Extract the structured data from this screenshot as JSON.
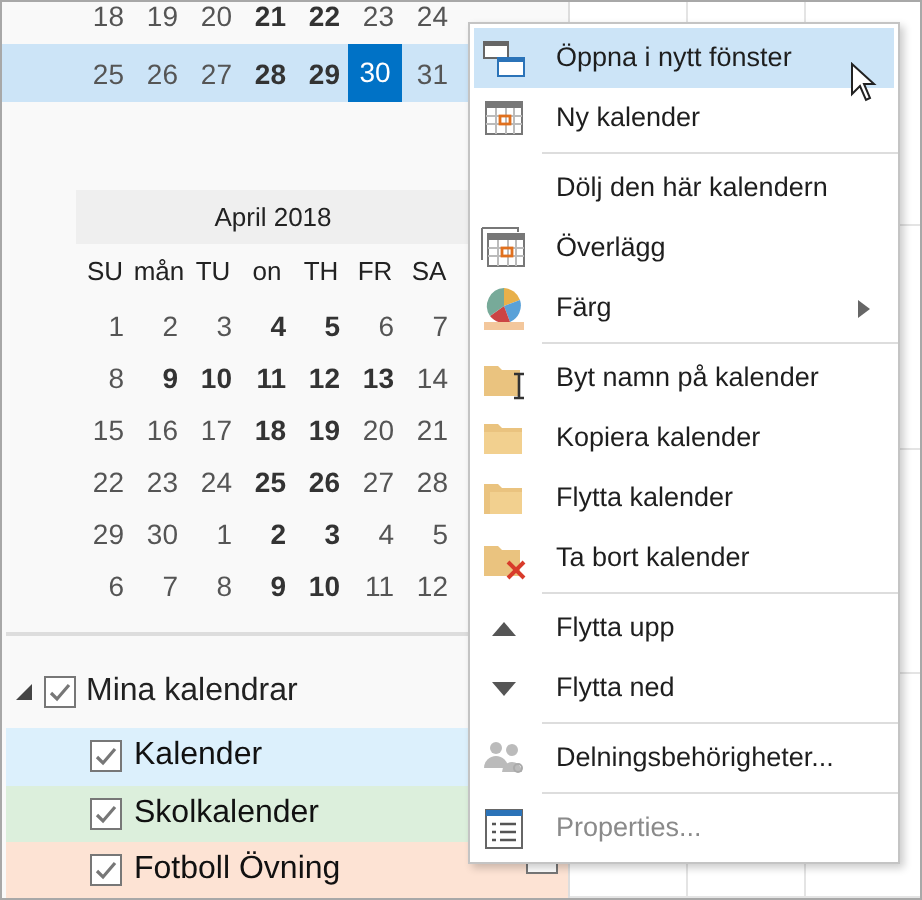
{
  "prev_month_rows": [
    {
      "selected": false,
      "days": [
        {
          "text": "18",
          "bold": false,
          "selected": false
        },
        {
          "text": "19",
          "bold": false,
          "selected": false
        },
        {
          "text": "20",
          "bold": false,
          "selected": false
        },
        {
          "text": "21",
          "bold": true,
          "selected": false
        },
        {
          "text": "22",
          "bold": true,
          "selected": false
        },
        {
          "text": "23",
          "bold": false,
          "selected": false
        },
        {
          "text": "24",
          "bold": false,
          "selected": false
        }
      ]
    },
    {
      "selected": true,
      "days": [
        {
          "text": "25",
          "bold": false,
          "selected": false
        },
        {
          "text": "26",
          "bold": false,
          "selected": false
        },
        {
          "text": "27",
          "bold": false,
          "selected": false
        },
        {
          "text": "28",
          "bold": true,
          "selected": false
        },
        {
          "text": "29",
          "bold": true,
          "selected": false
        },
        {
          "text": "30",
          "bold": false,
          "selected": true
        },
        {
          "text": "31",
          "bold": false,
          "selected": false
        }
      ]
    }
  ],
  "month": {
    "title": "April 2018",
    "weekdays": [
      "SU",
      "mån",
      "TU",
      "on",
      "TH",
      "FR",
      "SA"
    ],
    "rows": [
      {
        "selected": false,
        "days": [
          {
            "text": "1",
            "bold": false,
            "selected": false
          },
          {
            "text": "2",
            "bold": false,
            "selected": false
          },
          {
            "text": "3",
            "bold": false,
            "selected": false
          },
          {
            "text": "4",
            "bold": true,
            "selected": false
          },
          {
            "text": "5",
            "bold": true,
            "selected": false
          },
          {
            "text": "6",
            "bold": false,
            "selected": false
          },
          {
            "text": "7",
            "bold": false,
            "selected": false
          }
        ]
      },
      {
        "selected": false,
        "days": [
          {
            "text": "8",
            "bold": false,
            "selected": false
          },
          {
            "text": "9",
            "bold": true,
            "selected": false
          },
          {
            "text": "10",
            "bold": true,
            "selected": false
          },
          {
            "text": "11",
            "bold": true,
            "selected": false
          },
          {
            "text": "12",
            "bold": true,
            "selected": false
          },
          {
            "text": "13",
            "bold": true,
            "selected": false
          },
          {
            "text": "14",
            "bold": false,
            "selected": false
          }
        ]
      },
      {
        "selected": false,
        "days": [
          {
            "text": "15",
            "bold": false,
            "selected": false
          },
          {
            "text": "16",
            "bold": false,
            "selected": false
          },
          {
            "text": "17",
            "bold": false,
            "selected": false
          },
          {
            "text": "18",
            "bold": true,
            "selected": false
          },
          {
            "text": "19",
            "bold": true,
            "selected": false
          },
          {
            "text": "20",
            "bold": false,
            "selected": false
          },
          {
            "text": "21",
            "bold": false,
            "selected": false
          }
        ]
      },
      {
        "selected": false,
        "days": [
          {
            "text": "22",
            "bold": false,
            "selected": false
          },
          {
            "text": "23",
            "bold": false,
            "selected": false
          },
          {
            "text": "24",
            "bold": false,
            "selected": false
          },
          {
            "text": "25",
            "bold": true,
            "selected": false
          },
          {
            "text": "26",
            "bold": true,
            "selected": false
          },
          {
            "text": "27",
            "bold": false,
            "selected": false
          },
          {
            "text": "28",
            "bold": false,
            "selected": false
          }
        ]
      },
      {
        "selected": false,
        "days": [
          {
            "text": "29",
            "bold": false,
            "selected": false
          },
          {
            "text": "30",
            "bold": false,
            "selected": false
          },
          {
            "text": "1",
            "bold": false,
            "selected": false
          },
          {
            "text": "2",
            "bold": true,
            "selected": false
          },
          {
            "text": "3",
            "bold": true,
            "selected": false
          },
          {
            "text": "4",
            "bold": false,
            "selected": false
          },
          {
            "text": "5",
            "bold": false,
            "selected": false
          }
        ]
      },
      {
        "selected": false,
        "days": [
          {
            "text": "6",
            "bold": false,
            "selected": false
          },
          {
            "text": "7",
            "bold": false,
            "selected": false
          },
          {
            "text": "8",
            "bold": false,
            "selected": false
          },
          {
            "text": "9",
            "bold": true,
            "selected": false
          },
          {
            "text": "10",
            "bold": true,
            "selected": false
          },
          {
            "text": "11",
            "bold": false,
            "selected": false
          },
          {
            "text": "12",
            "bold": false,
            "selected": false
          }
        ]
      }
    ]
  },
  "calendar_groups": [
    {
      "label": "Mina kalendrar",
      "expanded": true,
      "checked": true,
      "children": [
        {
          "label": "Kalender",
          "checked": true,
          "color": "#dcf0fc"
        },
        {
          "label": "Skolkalender",
          "checked": true,
          "color": "#dcefdc"
        },
        {
          "label": "Fotboll Övning",
          "checked": true,
          "color": "#fde3d4"
        }
      ]
    }
  ],
  "trailing_checkbox": {
    "checked": false
  },
  "context_menu": {
    "sections": [
      {
        "items": [
          {
            "label": "Öppna i nytt fönster",
            "kind": "windows",
            "selected": true,
            "disabled": false,
            "submenu": false
          },
          {
            "label": "Ny kalender",
            "kind": "calendar",
            "selected": false,
            "disabled": false,
            "submenu": false
          }
        ]
      },
      {
        "items": [
          {
            "label": "Dölj den här kalendern",
            "kind": "plain",
            "selected": false,
            "disabled": false,
            "submenu": false
          },
          {
            "label": "Överlägg",
            "kind": "overlay",
            "selected": false,
            "disabled": false,
            "submenu": false
          },
          {
            "label": "Färg",
            "kind": "color",
            "selected": false,
            "disabled": false,
            "submenu": true
          }
        ]
      },
      {
        "items": [
          {
            "label": "Byt namn på kalender",
            "kind": "rename",
            "selected": false,
            "disabled": false,
            "submenu": false
          },
          {
            "label": "Kopiera kalender",
            "kind": "folder",
            "selected": false,
            "disabled": false,
            "submenu": false
          },
          {
            "label": "Flytta kalender",
            "kind": "folderback",
            "selected": false,
            "disabled": false,
            "submenu": false
          },
          {
            "label": "Ta bort kalender",
            "kind": "delete",
            "selected": false,
            "disabled": false,
            "submenu": false
          }
        ]
      },
      {
        "items": [
          {
            "label": "Flytta upp",
            "kind": "up",
            "selected": false,
            "disabled": false,
            "submenu": false
          },
          {
            "label": "Flytta ned",
            "kind": "down",
            "selected": false,
            "disabled": false,
            "submenu": false
          }
        ]
      },
      {
        "items": [
          {
            "label": "Delningsbehörigheter...",
            "kind": "people",
            "selected": false,
            "disabled": false,
            "submenu": false
          }
        ]
      },
      {
        "items": [
          {
            "label": "Properties...",
            "kind": "list",
            "selected": false,
            "disabled": true,
            "submenu": false
          }
        ]
      }
    ]
  }
}
